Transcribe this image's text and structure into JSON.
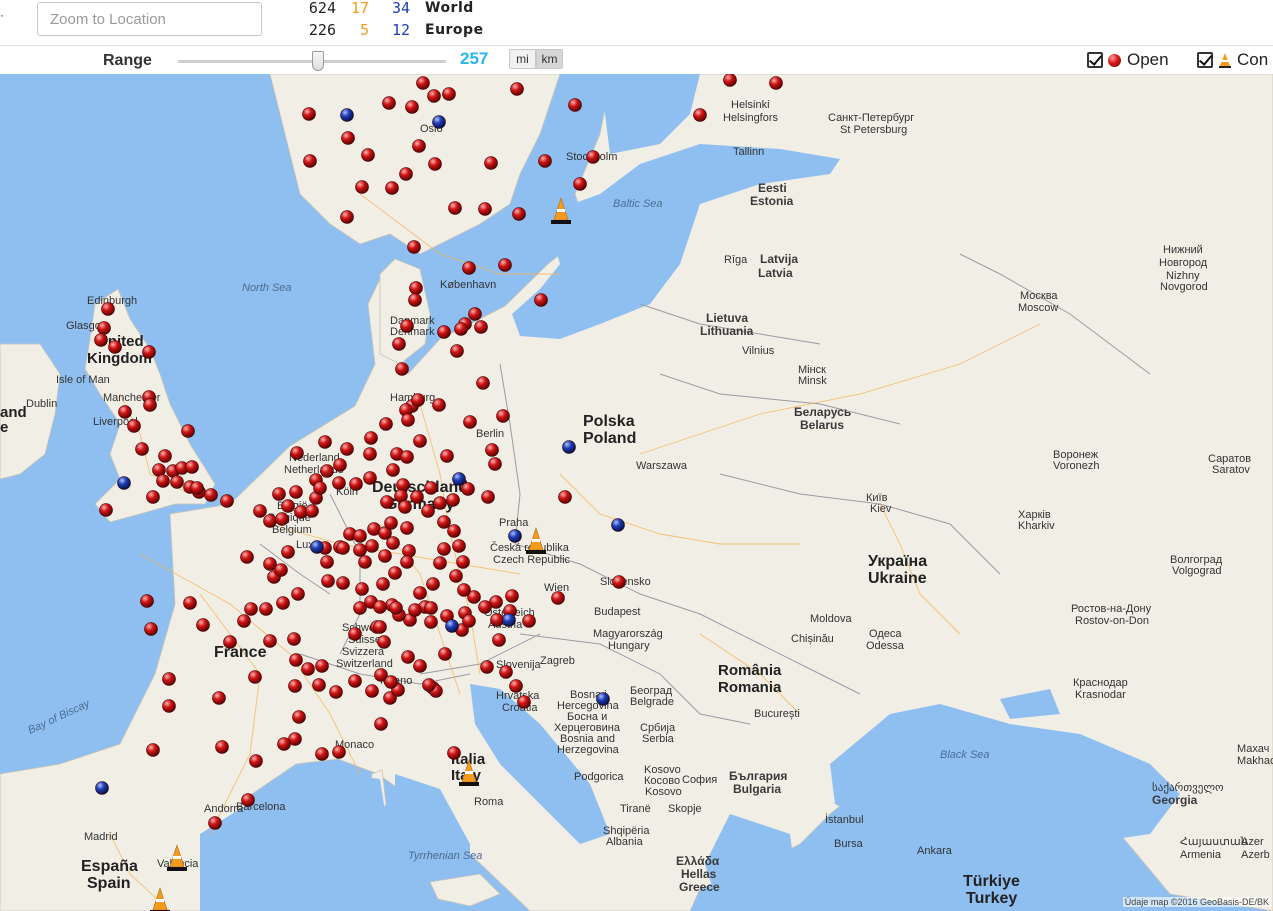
{
  "header": {
    "left_edge_mark": "·",
    "zoom_placeholder": "Zoom to Location",
    "stats": [
      {
        "n1": "624",
        "n2": "17",
        "n3": "34",
        "label": "World"
      },
      {
        "n1": "226",
        "n2": "5",
        "n3": "12",
        "label": "Europe"
      }
    ]
  },
  "range": {
    "label": "Range",
    "value": "257",
    "slider_fraction": 0.52,
    "unit_mi": "mi",
    "unit_km": "km",
    "selected_unit": "km"
  },
  "legend": {
    "open_label": "Open",
    "construction_label": "Con",
    "open_checked": true,
    "construction_checked": true
  },
  "colors": {
    "open_marker": "#c81414",
    "permit_marker": "#1e3cb5",
    "construction_cone": "#f39a1f",
    "range_value": "#2ab6e6",
    "water": "#8fbff0",
    "land": "#f1eee6"
  },
  "map": {
    "attribution": "Údaje map ©2016 GeoBasis-DE/BK",
    "sea_labels": [
      "North Sea",
      "Baltic Sea",
      "Bay of Biscay",
      "Black Sea",
      "Tyrrhenian Sea"
    ],
    "place_labels": {
      "united_kingdom": [
        "United",
        "Kingdom"
      ],
      "edinburgh": "Edinburgh",
      "glasgow": "Glasgow",
      "isle_of_man": "Isle of Man",
      "dublin": "Dublin",
      "manchester": "Manchester",
      "liverpool": "Liverpool",
      "ireland": "and",
      "ireland2": "e",
      "oslo": "Oslo",
      "stockholm": "Stockholm",
      "helsinki": "Helsinki",
      "helsingfors": "Helsingfors",
      "spb1": "Санкт-Петербург",
      "spb2": "St Petersburg",
      "tallinn": "Tallinn",
      "eesti": "Eesti",
      "estonia": "Estonia",
      "riga": "Rīga",
      "latvija": "Latvija",
      "latvia": "Latvia",
      "lietuva": "Lietuva",
      "lithuania": "Lithuania",
      "vilnius": "Vilnius",
      "nn1": "Нижний",
      "nn2": "Новгород",
      "nn3": "Nizhny",
      "nn4": "Novgorod",
      "moskva": "Москва",
      "moscow": "Moscow",
      "kobenhavn": "København",
      "danmark": "Danmark",
      "denmark": "Denmark",
      "hamburg": "Hamburg",
      "berlin": "Berlin",
      "polska": "Polska",
      "poland": "Poland",
      "warszawa": "Warszawa",
      "minsk1": "Мінск",
      "minsk2": "Minsk",
      "belarus1": "Беларусь",
      "belarus2": "Belarus",
      "nederland": "Nederland",
      "netherlands": "Netherlands",
      "belgie": "België",
      "belgique": "Belgique",
      "belgium": "Belgium",
      "koln": "Köln",
      "deutschland": "Deutschland",
      "germany": "Germany",
      "luxembourg": "Lux",
      "praha": "Praha",
      "ceska": "Česká republika",
      "czech": "Czech Republic",
      "slovensko": "Slovensko",
      "wien": "Wien",
      "osterreich": "Österreich",
      "austria": "Austria",
      "budapest": "Budapest",
      "magyar": "Magyarország",
      "hungary": "Hungary",
      "voronezh1": "Воронеж",
      "voronezh2": "Voronezh",
      "saratov1": "Саратов",
      "saratov2": "Saratov",
      "kyiv1": "Київ",
      "kyiv2": "Kiev",
      "kharkiv1": "Харків",
      "kharkiv2": "Kharkiv",
      "ukraina": "Україна",
      "ukraine": "Ukraine",
      "volgograd1": "Волгоград",
      "volgograd2": "Volgograd",
      "rostov1": "Ростов-на-Дону",
      "rostov2": "Rostov-on-Don",
      "moldova": "Moldova",
      "chisinau": "Chișinău",
      "odesa1": "Одеса",
      "odesa2": "Odessa",
      "krasnodar1": "Краснодар",
      "krasnodar2": "Krasnodar",
      "makhach1": "Махач",
      "makhach2": "Makhach",
      "france": "France",
      "schweiz": "Schweiz",
      "suisse": "Suisse",
      "svizzera": "Svizzera",
      "switzerland": "Switzerland",
      "milano": "Milano",
      "monaco": "Monaco",
      "slovenija": "Slovenija",
      "zagreb": "Zagreb",
      "hrvatska": "Hrvatska",
      "croatia": "Croatia",
      "bosna1": "Bosna i",
      "bosna2": "Hercegovina",
      "bosna3": "Босна и",
      "bosna4": "Херцеговина",
      "bosna5": "Bosnia and",
      "bosna6": "Herzegovina",
      "beograd1": "Београд",
      "beograd2": "Belgrade",
      "srbija": "Србија",
      "serbia": "Serbia",
      "romania1": "România",
      "romania2": "Romania",
      "bucuresti": "București",
      "bulgaria1": "България",
      "bulgaria2": "Bulgaria",
      "sofia": "София",
      "kosovo1": "Kosovo",
      "kosovo2": "Косово",
      "kosovo3": "Kosovo",
      "podgorica": "Podgorica",
      "tirane": "Tiranë",
      "shqiperia": "Shqipëria",
      "albania": "Albania",
      "macedonia": "Skopje",
      "italia": "Italia",
      "italy": "Italy",
      "roma": "Roma",
      "andorra": "Andorra",
      "barcelona": "Barcelona",
      "madrid": "Madrid",
      "espana": "España",
      "spain": "Spain",
      "valencia": "Valencia",
      "hellas1": "Ελλάδα",
      "hellas2": "Hellas",
      "greece": "Greece",
      "istanbul": "İstanbul",
      "bursa": "Bursa",
      "ankara": "Ankara",
      "turkiye": "Türkiye",
      "turkey": "Turkey",
      "georgia1": "საქართველო",
      "georgia2": "Georgia",
      "armenia1": "Հայաստան",
      "armenia2": "Armenia",
      "azerb1": "Azer",
      "azerb2": "Azerb"
    }
  }
}
